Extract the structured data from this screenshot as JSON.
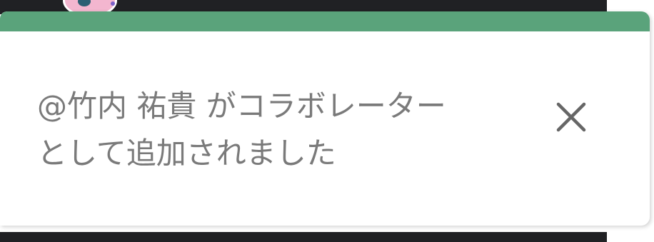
{
  "toast": {
    "message_line1": "@竹内 祐貴 がコラボレーター",
    "message_line2": "として追加されました",
    "close_icon": "close-icon",
    "accent_color": "#5aa37b"
  }
}
